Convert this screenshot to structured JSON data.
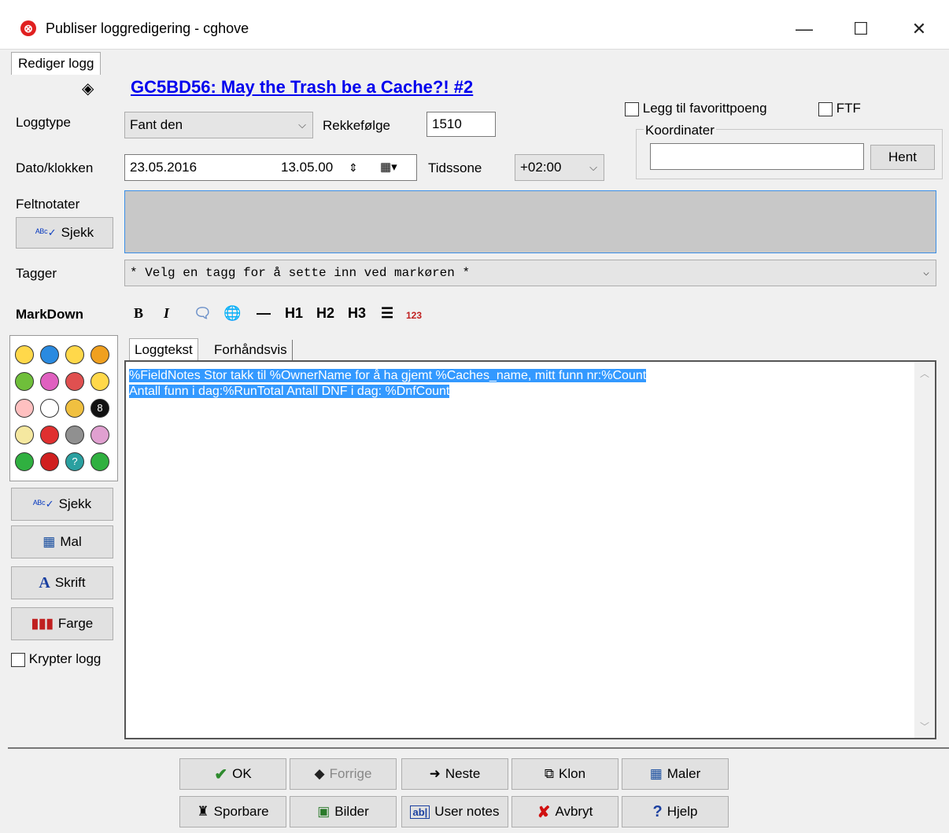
{
  "window": {
    "title": "Publiser loggredigering - cghove",
    "minimize": "—",
    "maximize": "☐",
    "close": "✕"
  },
  "top_tab": "Rediger logg",
  "cache_link": "GC5BD56: May the Trash be a Cache?! #2",
  "form": {
    "logtype_label": "Loggtype",
    "logtype_value": "Fant den",
    "order_label": "Rekkefølge",
    "order_value": "1510",
    "date_label": "Dato/klokken",
    "date_value": "23.05.2016",
    "time_value": "13.05.00",
    "tz_label": "Tidssone",
    "tz_value": "+02:00",
    "fieldnotes_label": "Feltnotater",
    "spell_label": "Sjekk",
    "tags_label": "Tagger",
    "tags_value": "* Velg en tagg for å sette inn ved markøren *"
  },
  "right_panel": {
    "favorite_label": "Legg til favorittpoeng",
    "ftf_label": "FTF",
    "coords_label": "Koordinater",
    "coords_value": "",
    "fetch_label": "Hent"
  },
  "markdown": {
    "label": "MarkDown",
    "bold": "B",
    "italic": "I",
    "hr": "—",
    "h1": "H1",
    "h2": "H2",
    "h3": "H3",
    "ol": "123"
  },
  "log_tabs": [
    "Loggtekst",
    "Forhåndsvis"
  ],
  "log_text": {
    "line1": "%FieldNotes Stor takk til %OwnerName for å ha gjemt %Caches_name, mitt funn nr:%Count",
    "line2": "Antall funn i dag:%RunTotal  Antall DNF i dag: %DnfCount"
  },
  "left_tools": {
    "spell": "Sjekk",
    "template": "Mal",
    "font": "Skrift",
    "color": "Farge",
    "encrypt": "Krypter logg"
  },
  "bottom_buttons": {
    "ok": "OK",
    "prev": "Forrige",
    "next": "Neste",
    "clone": "Klon",
    "templates": "Maler",
    "trackables": "Sporbare",
    "images": "Bilder",
    "user_notes": "User notes",
    "cancel": "Avbryt",
    "help": "Hjelp"
  },
  "colors": {
    "link": "#0000ee",
    "selection": "#3399ff",
    "ok_check": "#2e8b2e",
    "cancel_x": "#d01010"
  }
}
